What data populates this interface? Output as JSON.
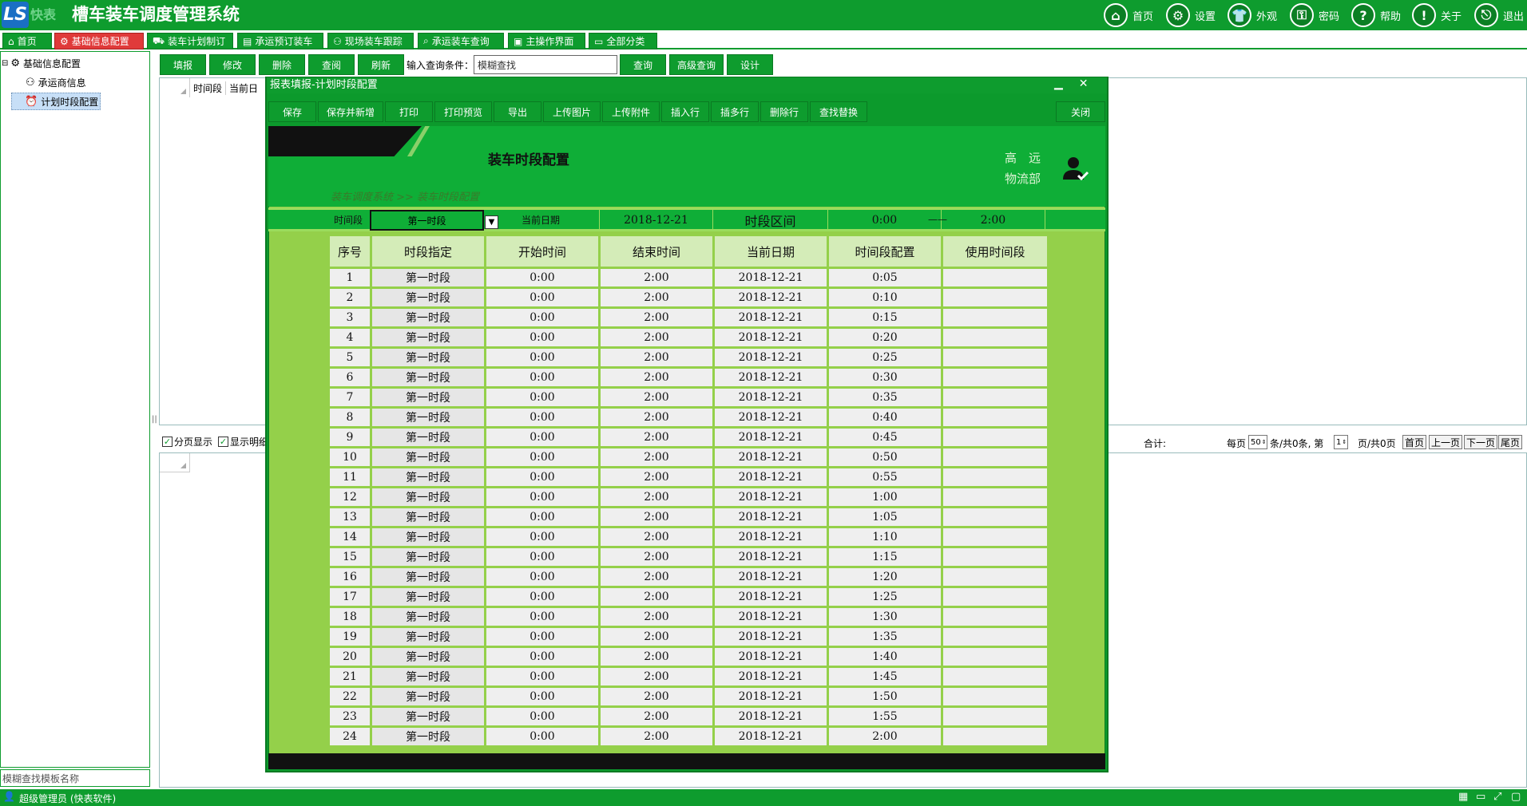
{
  "app": {
    "logo_text": "LS",
    "logo_sub": "快表",
    "title": "槽车装车调度管理系统"
  },
  "topnav": [
    {
      "label": "首页",
      "icon": "home-icon",
      "glyph": "⌂"
    },
    {
      "label": "设置",
      "icon": "gear-icon",
      "glyph": "⚙"
    },
    {
      "label": "外观",
      "icon": "shirt-icon",
      "glyph": "👕"
    },
    {
      "label": "密码",
      "icon": "key-icon",
      "glyph": "⚿"
    },
    {
      "label": "帮助",
      "icon": "help-icon",
      "glyph": "?"
    },
    {
      "label": "关于",
      "icon": "info-icon",
      "glyph": "!"
    },
    {
      "label": "退出",
      "icon": "exit-icon",
      "glyph": "⎋"
    }
  ],
  "tabs": [
    {
      "label": "首页",
      "icon": "home-icon",
      "glyph": "⌂",
      "active": false
    },
    {
      "label": "基础信息配置",
      "icon": "gears-icon",
      "glyph": "⚙",
      "active": true
    },
    {
      "label": "装车计划制订",
      "icon": "truck-icon",
      "glyph": "⛟",
      "active": false
    },
    {
      "label": "承运预订装车",
      "icon": "chart-icon",
      "glyph": "▤",
      "active": false
    },
    {
      "label": "现场装车跟踪",
      "icon": "people-icon",
      "glyph": "⚇",
      "active": false
    },
    {
      "label": "承运装车查询",
      "icon": "search-icon",
      "glyph": "⌕",
      "active": false
    },
    {
      "label": "主操作界面",
      "icon": "doc-icon",
      "glyph": "▣",
      "active": false
    },
    {
      "label": "全部分类",
      "icon": "folder-icon",
      "glyph": "▭",
      "active": false
    }
  ],
  "tree": {
    "root": "基础信息配置",
    "items": [
      "承运商信息",
      "计划时段配置"
    ],
    "selected": "计划时段配置",
    "search_placeholder": "模糊查找模板名称"
  },
  "toolbar": {
    "buttons": [
      "填报",
      "修改",
      "删除",
      "查阅",
      "刷新"
    ],
    "query_label": "输入查询条件：",
    "query_value": "模糊查找",
    "right_buttons": [
      "查询",
      "高级查询",
      "设计"
    ]
  },
  "grid": {
    "columns": [
      "时间段",
      "当前日"
    ],
    "paging_label": "分页显示",
    "show_detail_label": "显示明细",
    "total_label": "合计:",
    "per_page_label": "每页",
    "per_page": "50",
    "records_text": "条/共0条, 第",
    "page_num": "1",
    "pages_text": "页/共0页",
    "first_label": "首页",
    "prev_label": "上一页",
    "next_label": "下一页",
    "last_label": "尾页"
  },
  "dialog": {
    "title": "报表填报-计划时段配置",
    "min_glyph": "▁",
    "close_glyph": "✕",
    "buttons": [
      "保存",
      "保存并新增",
      "打印",
      "打印预览",
      "导出",
      "上传图片",
      "上传附件",
      "插入行",
      "插多行",
      "删除行",
      "查找替换"
    ],
    "close_button": "关闭",
    "form_title": "装车时段配置",
    "company_line1": "高　远",
    "company_line2": "物流部",
    "breadcrumb": "装车调度系统 >> 装车时段配置",
    "filter": {
      "period_label": "时间段",
      "period_value": "第一时段",
      "date_label": "当前日期",
      "date_value": "2018-12-21",
      "range_label": "时段区间",
      "range_start": "0:00",
      "range_dash": "——",
      "range_end": "2:00"
    },
    "table": {
      "headers": [
        "序号",
        "时段指定",
        "开始时间",
        "结束时间",
        "当前日期",
        "时间段配置",
        "使用时间段"
      ],
      "rows": [
        [
          "1",
          "第一时段",
          "0:00",
          "2:00",
          "2018-12-21",
          "0:05",
          ""
        ],
        [
          "2",
          "第一时段",
          "0:00",
          "2:00",
          "2018-12-21",
          "0:10",
          ""
        ],
        [
          "3",
          "第一时段",
          "0:00",
          "2:00",
          "2018-12-21",
          "0:15",
          ""
        ],
        [
          "4",
          "第一时段",
          "0:00",
          "2:00",
          "2018-12-21",
          "0:20",
          ""
        ],
        [
          "5",
          "第一时段",
          "0:00",
          "2:00",
          "2018-12-21",
          "0:25",
          ""
        ],
        [
          "6",
          "第一时段",
          "0:00",
          "2:00",
          "2018-12-21",
          "0:30",
          ""
        ],
        [
          "7",
          "第一时段",
          "0:00",
          "2:00",
          "2018-12-21",
          "0:35",
          ""
        ],
        [
          "8",
          "第一时段",
          "0:00",
          "2:00",
          "2018-12-21",
          "0:40",
          ""
        ],
        [
          "9",
          "第一时段",
          "0:00",
          "2:00",
          "2018-12-21",
          "0:45",
          ""
        ],
        [
          "10",
          "第一时段",
          "0:00",
          "2:00",
          "2018-12-21",
          "0:50",
          ""
        ],
        [
          "11",
          "第一时段",
          "0:00",
          "2:00",
          "2018-12-21",
          "0:55",
          ""
        ],
        [
          "12",
          "第一时段",
          "0:00",
          "2:00",
          "2018-12-21",
          "1:00",
          ""
        ],
        [
          "13",
          "第一时段",
          "0:00",
          "2:00",
          "2018-12-21",
          "1:05",
          ""
        ],
        [
          "14",
          "第一时段",
          "0:00",
          "2:00",
          "2018-12-21",
          "1:10",
          ""
        ],
        [
          "15",
          "第一时段",
          "0:00",
          "2:00",
          "2018-12-21",
          "1:15",
          ""
        ],
        [
          "16",
          "第一时段",
          "0:00",
          "2:00",
          "2018-12-21",
          "1:20",
          ""
        ],
        [
          "17",
          "第一时段",
          "0:00",
          "2:00",
          "2018-12-21",
          "1:25",
          ""
        ],
        [
          "18",
          "第一时段",
          "0:00",
          "2:00",
          "2018-12-21",
          "1:30",
          ""
        ],
        [
          "19",
          "第一时段",
          "0:00",
          "2:00",
          "2018-12-21",
          "1:35",
          ""
        ],
        [
          "20",
          "第一时段",
          "0:00",
          "2:00",
          "2018-12-21",
          "1:40",
          ""
        ],
        [
          "21",
          "第一时段",
          "0:00",
          "2:00",
          "2018-12-21",
          "1:45",
          ""
        ],
        [
          "22",
          "第一时段",
          "0:00",
          "2:00",
          "2018-12-21",
          "1:50",
          ""
        ],
        [
          "23",
          "第一时段",
          "0:00",
          "2:00",
          "2018-12-21",
          "1:55",
          ""
        ],
        [
          "24",
          "第一时段",
          "0:00",
          "2:00",
          "2018-12-21",
          "2:00",
          ""
        ]
      ]
    }
  },
  "status": {
    "user": "超级管理员 (快表软件)"
  },
  "colors": {
    "brand_green": "#0e9c2e",
    "active_tab_red": "#e03a3a",
    "table_bg": "#94d04a"
  }
}
